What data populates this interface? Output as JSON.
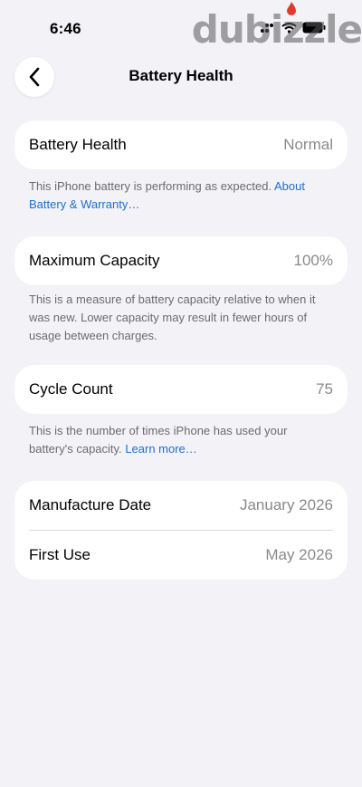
{
  "status_bar": {
    "time": "6:46",
    "watermark": "dubizzle"
  },
  "nav": {
    "title": "Battery Health",
    "back_icon": "chevron-left-icon"
  },
  "battery_health": {
    "label": "Battery Health",
    "value": "Normal",
    "footnote_text": "This iPhone battery is performing as expected.",
    "footnote_link": "About Battery & Warranty…"
  },
  "maximum_capacity": {
    "label": "Maximum Capacity",
    "value": "100%",
    "footnote_text": "This is a measure of battery capacity relative to when it was new. Lower capacity may result in fewer hours of usage between charges."
  },
  "cycle_count": {
    "label": "Cycle Count",
    "value": "75",
    "footnote_text": "This is the number of times iPhone has used your battery's capacity.",
    "footnote_link": "Learn more…"
  },
  "dates": {
    "manufacture_label": "Manufacture Date",
    "manufacture_value": "January 2026",
    "first_use_label": "First Use",
    "first_use_value": "May 2026"
  },
  "colors": {
    "background": "#f2f2f7",
    "link": "#1f6fd6",
    "secondary_text": "#8a8a8e"
  }
}
